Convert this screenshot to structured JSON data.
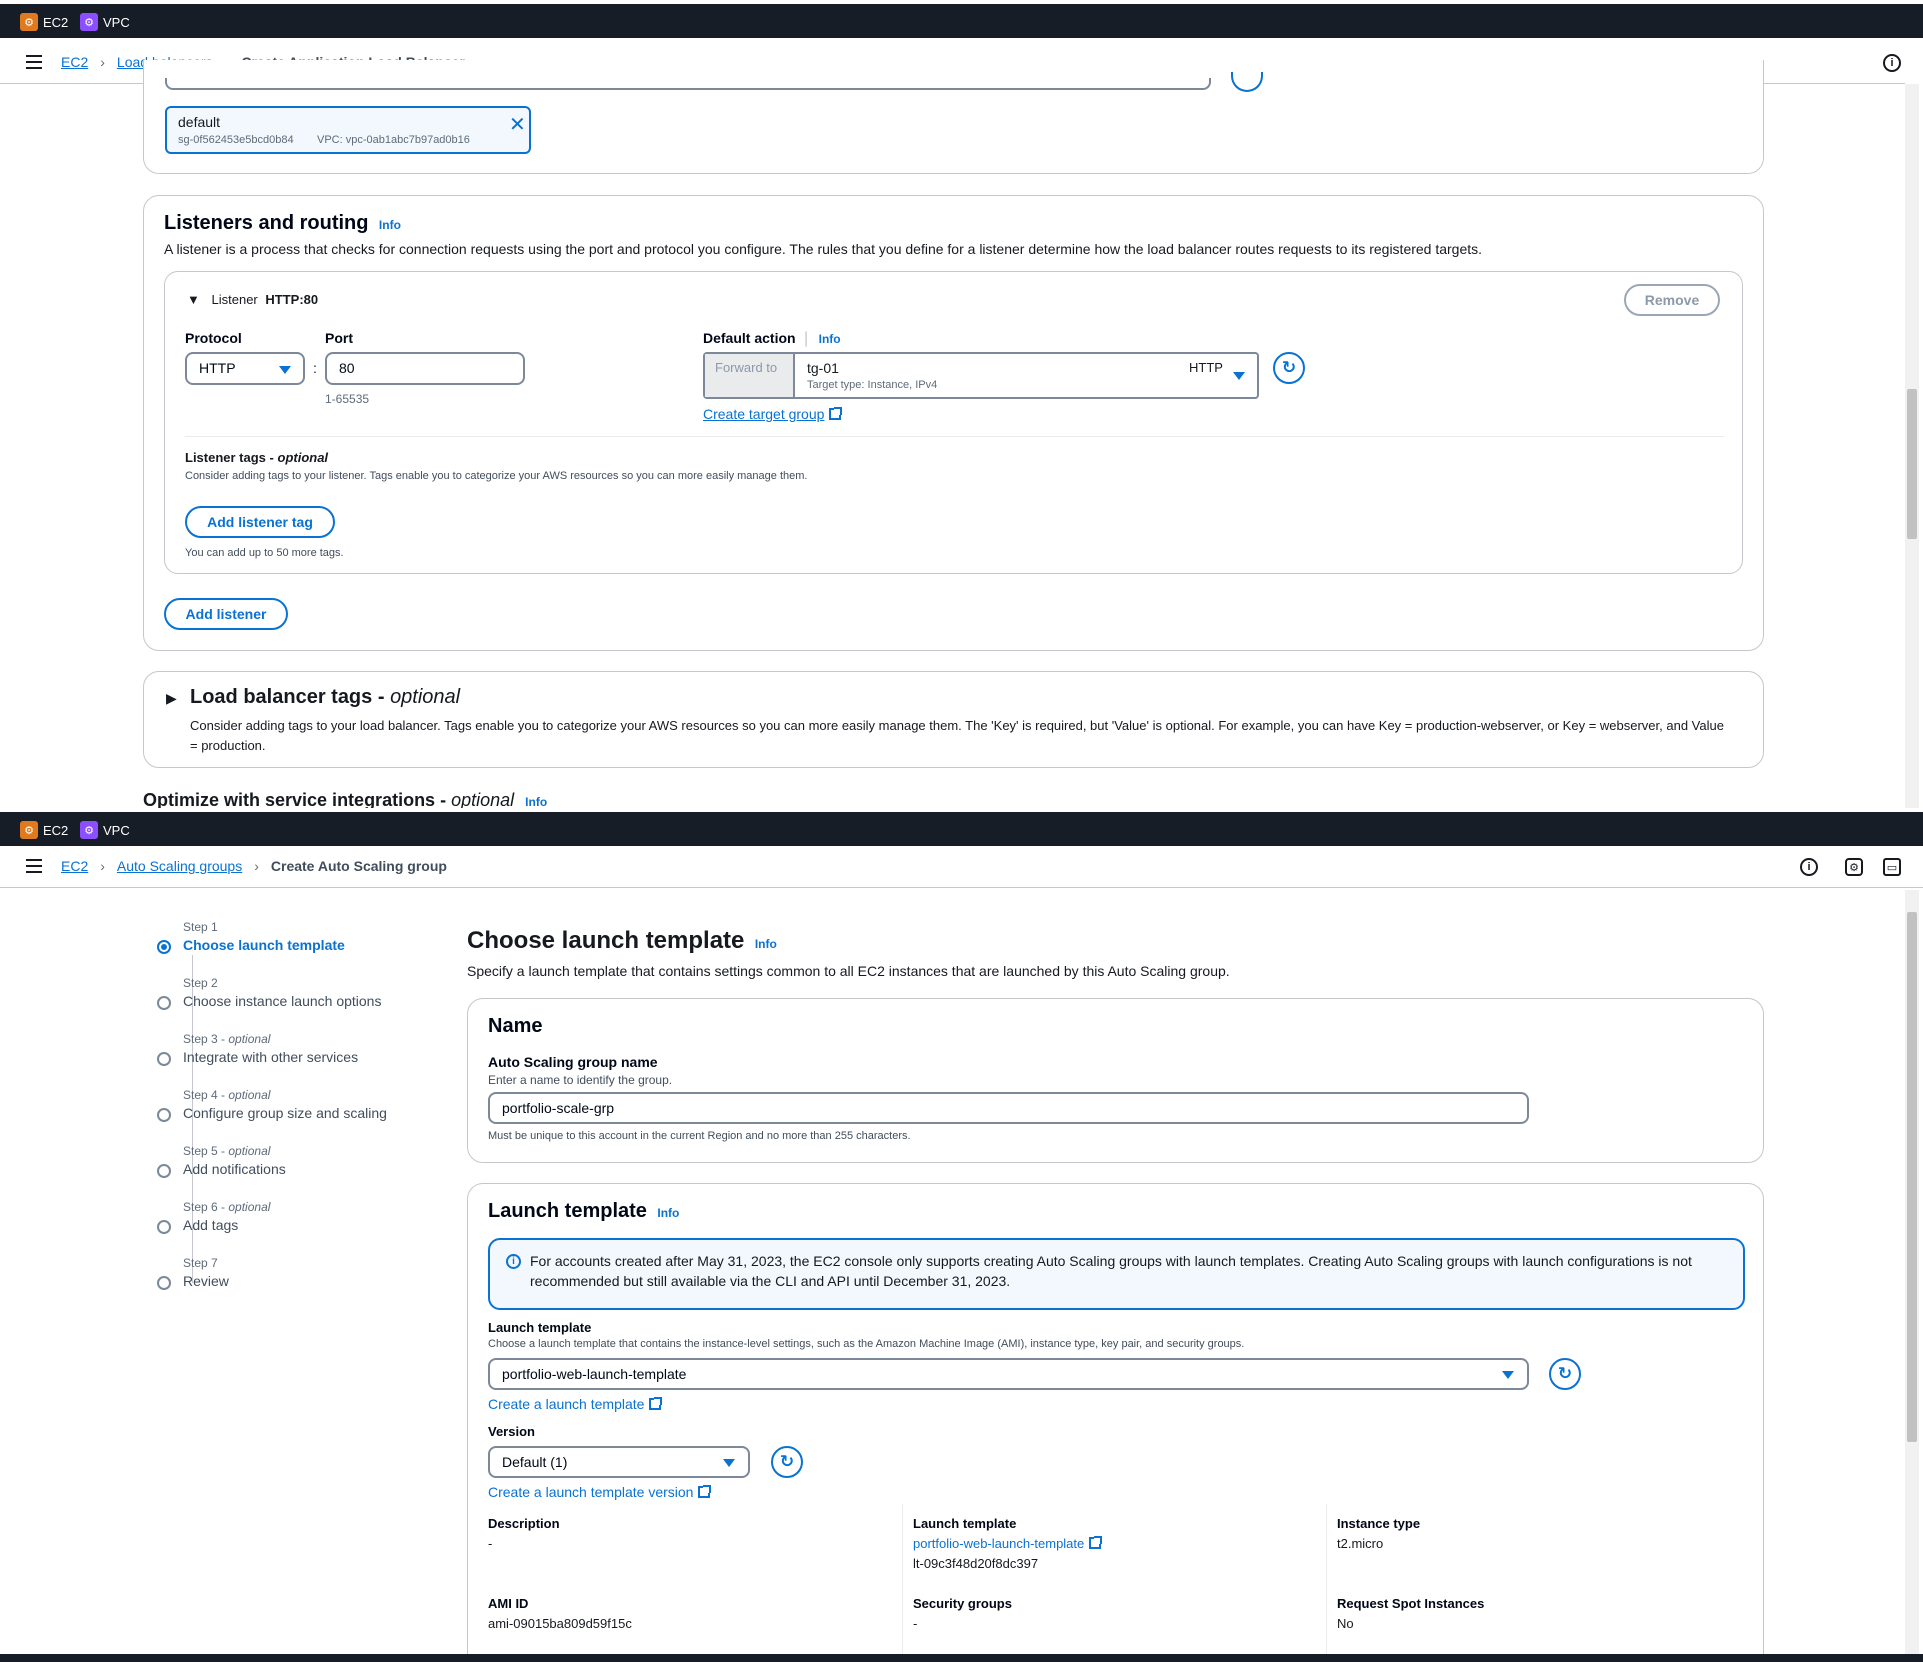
{
  "top": {
    "services": [
      "EC2",
      "VPC"
    ],
    "breadcrumb": {
      "home": "EC2",
      "parent": "Load balancers",
      "current": "Create Application Load Balancer"
    },
    "security_group_token": {
      "name": "default",
      "id": "sg-0f562453e5bcd0b84",
      "vpc": "VPC: vpc-0ab1abc7b97ad0b16"
    },
    "listeners": {
      "title": "Listeners and routing",
      "info": "Info",
      "description": "A listener is a process that checks for connection requests using the port and protocol you configure. The rules that you define for a listener determine how the load balancer routes requests to its registered targets.",
      "listener_label": "Listener",
      "listener_name": "HTTP:80",
      "remove": "Remove",
      "protocol_label": "Protocol",
      "protocol_value": "HTTP",
      "port_label": "Port",
      "port_value": "80",
      "port_hint": "1-65535",
      "colon": ":",
      "default_action_label": "Default action",
      "default_action_info": "Info",
      "forward_to": "Forward to",
      "target_group": "tg-01",
      "target_group_protocol": "HTTP",
      "target_type": "Target type: Instance, IPv4",
      "create_target_group": "Create target group",
      "tags_title": "Listener tags",
      "tags_optional": "optional",
      "tags_description": "Consider adding tags to your listener. Tags enable you to categorize your AWS resources so you can more easily manage them.",
      "add_tag": "Add listener tag",
      "tags_hint": "You can add up to 50 more tags.",
      "add_listener": "Add listener"
    },
    "lb_tags": {
      "title": "Load balancer tags",
      "optional": "optional",
      "description": "Consider adding tags to your load balancer. Tags enable you to categorize your AWS resources so you can more easily manage them. The 'Key' is required, but 'Value' is optional. For example, you can have Key = production-webserver, or Key = webserver, and Value = production."
    },
    "optimize": {
      "title": "Optimize with service integrations",
      "optional": "optional",
      "info": "Info"
    }
  },
  "bottom": {
    "services": [
      "EC2",
      "VPC"
    ],
    "breadcrumb": {
      "home": "EC2",
      "parent": "Auto Scaling groups",
      "current": "Create Auto Scaling group"
    },
    "steps": [
      {
        "num": "Step 1",
        "optional": "",
        "name": "Choose launch template"
      },
      {
        "num": "Step 2",
        "optional": "",
        "name": "Choose instance launch options"
      },
      {
        "num": "Step 3",
        "optional": "optional",
        "name": "Integrate with other services"
      },
      {
        "num": "Step 4",
        "optional": "optional",
        "name": "Configure group size and scaling"
      },
      {
        "num": "Step 5",
        "optional": "optional",
        "name": "Add notifications"
      },
      {
        "num": "Step 6",
        "optional": "optional",
        "name": "Add tags"
      },
      {
        "num": "Step 7",
        "optional": "",
        "name": "Review"
      }
    ],
    "page_title": "Choose launch template",
    "page_info": "Info",
    "page_description": "Specify a launch template that contains settings common to all EC2 instances that are launched by this Auto Scaling group.",
    "name_panel": {
      "title": "Name",
      "field_label": "Auto Scaling group name",
      "field_desc": "Enter a name to identify the group.",
      "field_value": "portfolio-scale-grp",
      "field_hint": "Must be unique to this account in the current Region and no more than 255 characters."
    },
    "lt_panel": {
      "title": "Launch template",
      "info": "Info",
      "alert": "For accounts created after May 31, 2023, the EC2 console only supports creating Auto Scaling groups with launch templates. Creating Auto Scaling groups with launch configurations is not recommended but still available via the CLI and API until December 31, 2023.",
      "lt_label": "Launch template",
      "lt_desc": "Choose a launch template that contains the instance-level settings, such as the Amazon Machine Image (AMI), instance type, key pair, and security groups.",
      "lt_value": "portfolio-web-launch-template",
      "create_lt": "Create a launch template",
      "version_label": "Version",
      "version_value": "Default (1)",
      "create_version": "Create a launch template version",
      "details": {
        "description_label": "Description",
        "description_value": "-",
        "lt_label": "Launch template",
        "lt_link": "portfolio-web-launch-template",
        "lt_id": "lt-09c3f48d20f8dc397",
        "instance_type_label": "Instance type",
        "instance_type_value": "t2.micro",
        "ami_label": "AMI ID",
        "ami_value": "ami-09015ba809d59f15c",
        "sg_label": "Security groups",
        "sg_value": "-",
        "spot_label": "Request Spot Instances",
        "spot_value": "No"
      }
    }
  }
}
